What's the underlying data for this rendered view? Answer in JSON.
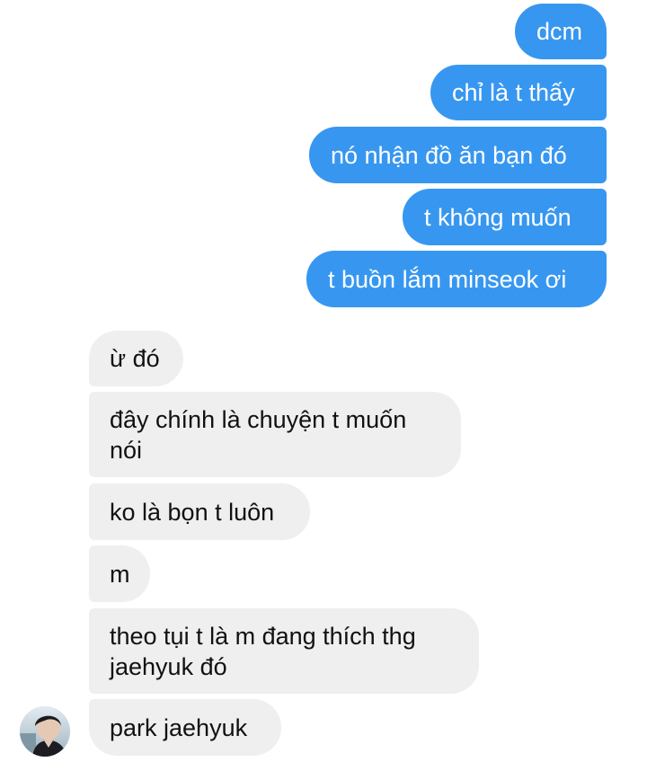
{
  "conversation": {
    "sent": [
      {
        "text": "dcm"
      },
      {
        "text": "chỉ là t thấy"
      },
      {
        "text": "nó nhận đồ ăn bạn đó"
      },
      {
        "text": "t không muốn"
      },
      {
        "text": "t buồn lắm minseok ơi"
      }
    ],
    "received": [
      {
        "lines": [
          "ừ đó"
        ]
      },
      {
        "lines": [
          "đây chính là chuyện t muốn",
          "nói"
        ]
      },
      {
        "lines": [
          "ko là bọn t luôn"
        ]
      },
      {
        "lines": [
          "m"
        ]
      },
      {
        "lines": [
          "theo tụi t là m đang thích thg",
          "jaehyuk đó"
        ]
      },
      {
        "lines": [
          "park jaehyuk"
        ]
      }
    ]
  },
  "colors": {
    "sent_bubble": "#3797f0",
    "received_bubble": "#efefef"
  }
}
